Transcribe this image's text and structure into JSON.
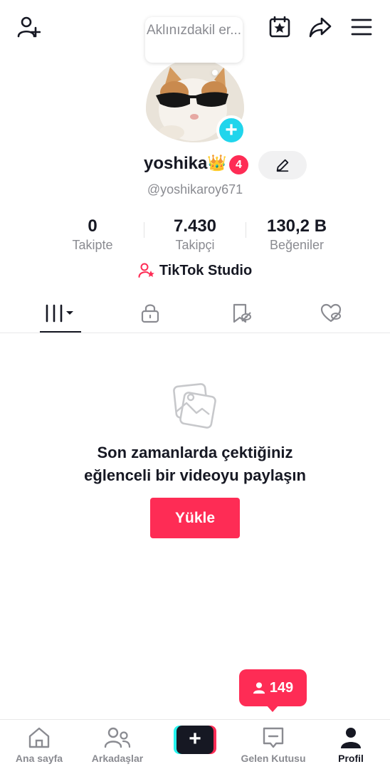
{
  "header": {
    "add_friend_icon": "person-add-icon",
    "calendar_icon": "calendar-star-icon",
    "share_icon": "share-arrow-icon",
    "menu_icon": "hamburger-menu-icon"
  },
  "profile": {
    "thought_bubble": "Aklınızdakil er...",
    "username": "yoshika",
    "crown": "👑",
    "notification_count": "4",
    "handle": "@yoshikaroy671",
    "stats": [
      {
        "value": "0",
        "label": "Takipte"
      },
      {
        "value": "7.430",
        "label": "Takipçi"
      },
      {
        "value": "130,2 B",
        "label": "Beğeniler"
      }
    ],
    "studio_label": "TikTok Studio"
  },
  "tabs": [
    {
      "icon": "grid-videos-icon",
      "active": true
    },
    {
      "icon": "lock-icon"
    },
    {
      "icon": "bookmark-icon"
    },
    {
      "icon": "liked-heart-icon"
    }
  ],
  "empty_state": {
    "line1": "Son zamanlarda çektiğiniz",
    "line2": "eğlenceli bir videoyu paylaşın",
    "upload_label": "Yükle"
  },
  "followers_pill": {
    "count": "149"
  },
  "bottom_nav": {
    "items": [
      {
        "label": "Ana sayfa",
        "icon": "home-icon"
      },
      {
        "label": "Arkadaşlar",
        "icon": "friends-icon"
      },
      {
        "label": "",
        "icon": "create-plus-icon"
      },
      {
        "label": "Gelen Kutusu",
        "icon": "inbox-icon"
      },
      {
        "label": "Profil",
        "icon": "profile-icon",
        "active": true
      }
    ]
  },
  "colors": {
    "accent": "#fe2c55",
    "cyan": "#20d5ec",
    "text": "#161823",
    "muted": "#8a8b91"
  }
}
